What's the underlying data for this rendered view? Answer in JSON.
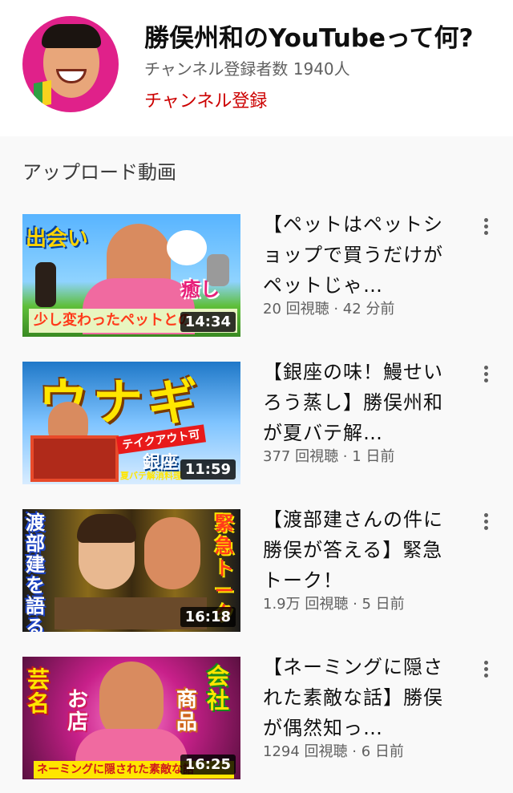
{
  "channel": {
    "title": "勝俣州和のYouTubeって何?",
    "subscribers": "チャンネル登録者数 1940人",
    "subscribe_label": "チャンネル登録"
  },
  "section_title": "アップロード動画",
  "videos": [
    {
      "title": "【ペットはペットショップで買うだけがペットじゃ…",
      "meta": "20 回視聴 · 42 分前",
      "duration": "14:34",
      "thumb_texts": [
        "出会い",
        "癒し",
        "少し変わったペットとの"
      ]
    },
    {
      "title": "【銀座の味！鰻せいろう蒸し】勝俣州和が夏バテ解…",
      "meta": "377 回視聴 · 1 日前",
      "duration": "11:59",
      "thumb_texts": [
        "ウナギ",
        "テイクアウト可",
        "銀座",
        "夏バテ解消料理"
      ]
    },
    {
      "title": "【渡部建さんの件に勝俣が答える】緊急トーク！",
      "meta": "1.9万 回視聴 · 5 日前",
      "duration": "16:18",
      "thumb_texts": [
        "渡部建を語る",
        "緊急トーク"
      ]
    },
    {
      "title": "【ネーミングに隠された素敵な話】勝俣が偶然知っ…",
      "meta": "1294 回視聴 · 6 日前",
      "duration": "16:25",
      "thumb_texts": [
        "芸名",
        "お店",
        "会社",
        "商品",
        "ネーミングに隠された素敵な話"
      ]
    }
  ]
}
